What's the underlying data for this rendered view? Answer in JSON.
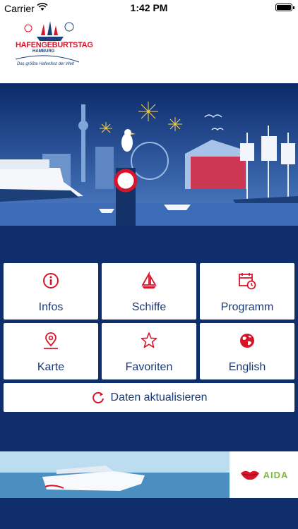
{
  "status_bar": {
    "carrier": "Carrier",
    "time": "1:42 PM"
  },
  "header": {
    "logo_title": "HAFENGEBURTSTAG",
    "logo_subtitle": "HAMBURG",
    "logo_tagline": "Das größte Hafenfest der Welt"
  },
  "menu": {
    "tiles": [
      {
        "label": "Infos",
        "icon": "info-icon"
      },
      {
        "label": "Schiffe",
        "icon": "sailboat-icon"
      },
      {
        "label": "Programm",
        "icon": "calendar-clock-icon"
      },
      {
        "label": "Karte",
        "icon": "map-pin-icon"
      },
      {
        "label": "Favoriten",
        "icon": "star-icon"
      },
      {
        "label": "English",
        "icon": "globe-icon"
      }
    ],
    "refresh_label": "Daten aktualisieren"
  },
  "ad": {
    "brand": "AIDA"
  },
  "colors": {
    "accent_red": "#d8142a",
    "navy": "#0f2e6b",
    "text_blue": "#1a3a75"
  }
}
